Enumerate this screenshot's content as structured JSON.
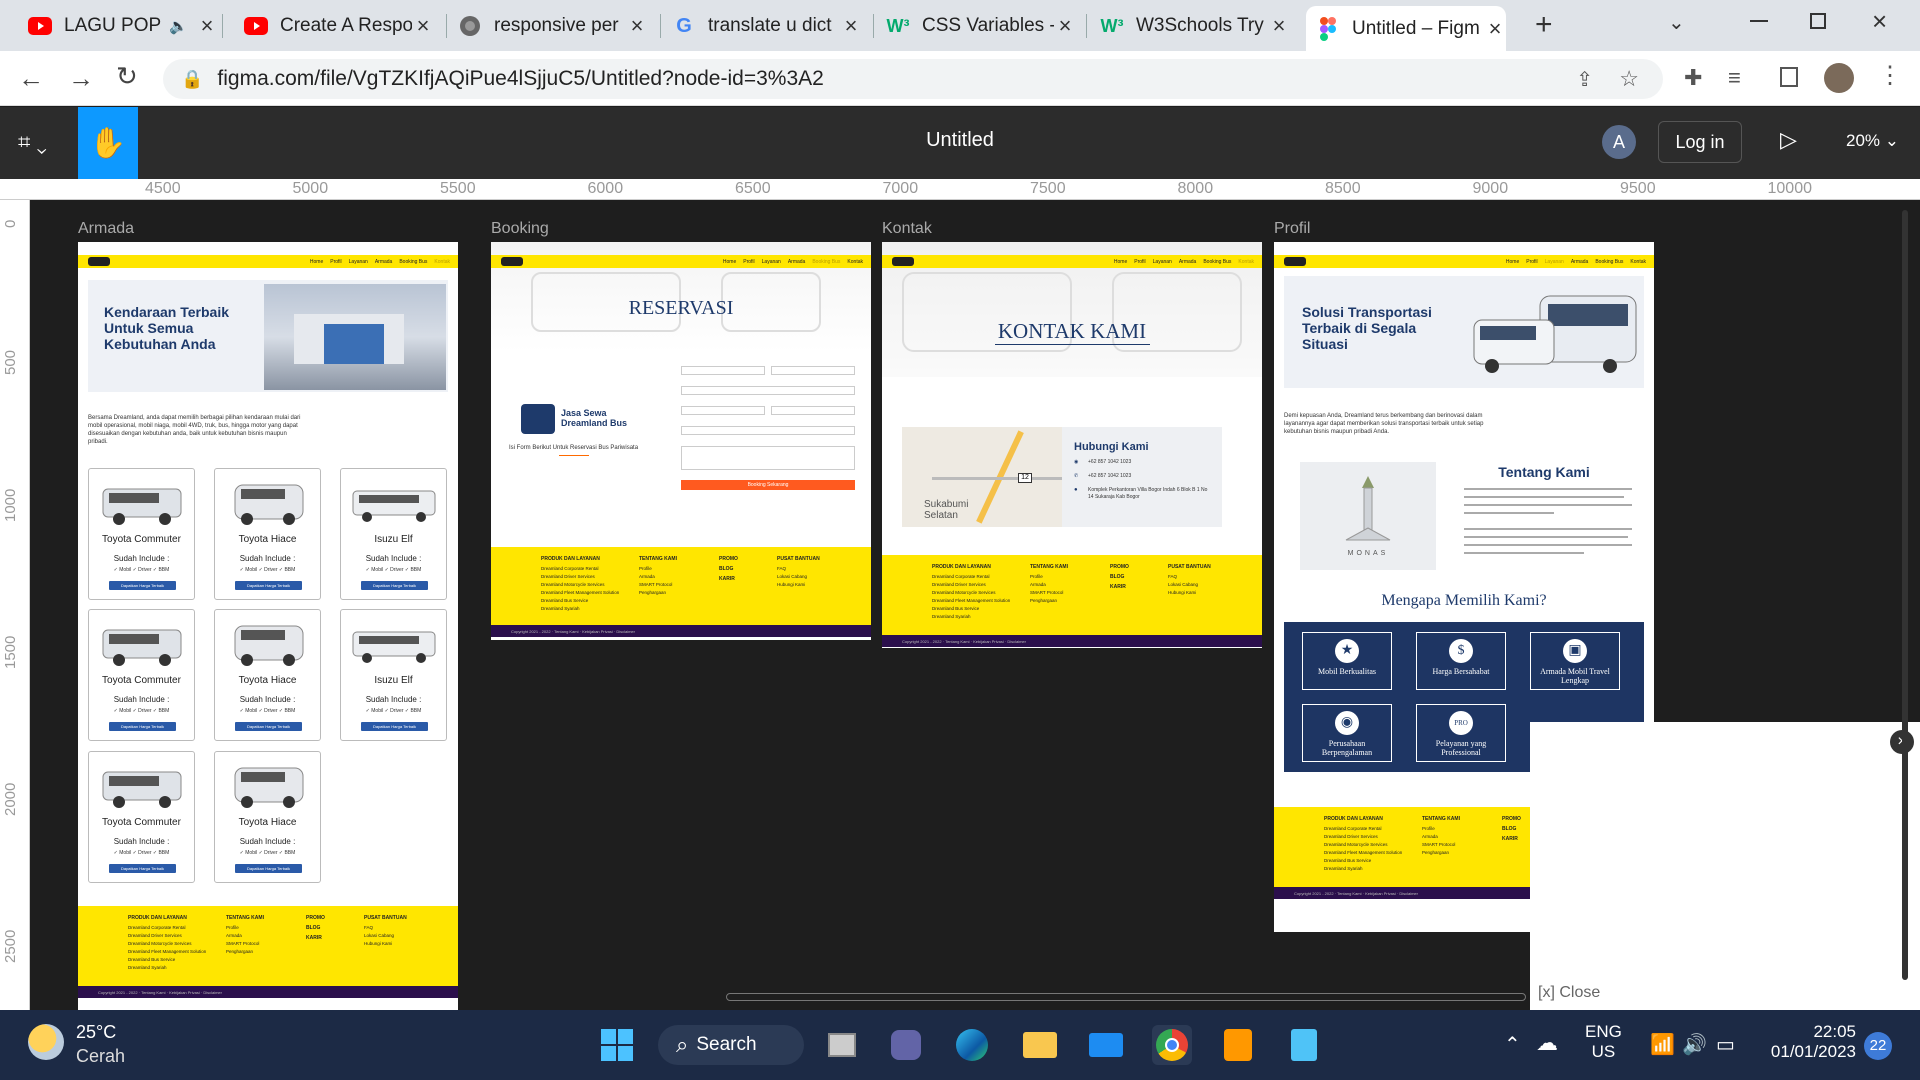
{
  "browser": {
    "tabs": [
      {
        "title": "LAGU POP",
        "icon": "youtube-icon",
        "x": 0
      },
      {
        "title": "Create A Respo",
        "icon": "youtube-icon"
      },
      {
        "title": "responsive per",
        "icon": "globe-icon"
      },
      {
        "title": "translate u dict",
        "icon": "google-icon"
      },
      {
        "title": "CSS Variables -",
        "icon": "w3schools-icon"
      },
      {
        "title": "W3Schools Try",
        "icon": "w3schools-icon"
      },
      {
        "title": "Untitled – Figm",
        "icon": "figma-icon"
      }
    ],
    "url": "figma.com/file/VgTZKIfjAQiPue4lSjjuC5/Untitled?node-id=3%3A2"
  },
  "figma": {
    "title": "Untitled",
    "avatar_letter": "A",
    "login": "Log in",
    "zoom": "20%",
    "ruler_x": [
      "4500",
      "5000",
      "5500",
      "6000",
      "6500",
      "7000",
      "7500",
      "8000",
      "8500",
      "9000",
      "9500",
      "10000"
    ],
    "ruler_y": [
      "0",
      "500",
      "1000",
      "1500",
      "2000",
      "2500"
    ]
  },
  "frames": {
    "armada": {
      "label": "Armada",
      "nav": [
        "Home",
        "Profil",
        "Layanan",
        "Armada",
        "Booking Bus",
        "Kontak"
      ],
      "hero_title": "Kendaraan Terbaik Untuk Semua Kebutuhan Anda",
      "intro": "Bersama Dreamland, anda dapat memilih berbagai pilihan kendaraan mulai dari mobil operasional, mobil niaga, mobil 4WD, truk, bus, hingga motor yang dapat disesuaikan dengan kebutuhan anda, baik untuk kebutuhan bisnis maupun pribadi.",
      "cards": [
        {
          "name": "Toyota Commuter"
        },
        {
          "name": "Toyota Hiace"
        },
        {
          "name": "Isuzu Elf"
        },
        {
          "name": "Toyota Commuter"
        },
        {
          "name": "Toyota Hiace"
        },
        {
          "name": "Isuzu Elf"
        },
        {
          "name": "Toyota Commuter"
        },
        {
          "name": "Toyota Hiace"
        }
      ],
      "include_label": "Sudah Include :",
      "include_items": "✓ Mobil   ✓ Driver   ✓ BBM",
      "cta": "Dapatkan Harga Terbaik"
    },
    "booking": {
      "label": "Booking",
      "nav": [
        "Home",
        "Profil",
        "Layanan",
        "Armada",
        "Booking Bus",
        "Kontak"
      ],
      "hero": "RESERVASI",
      "brand": "Jasa Sewa Dreamland Bus",
      "sub": "Isi Form Berikut Untuk Reservasi Bus Pariwisata",
      "submit": "Booking Sekarang"
    },
    "kontak": {
      "label": "Kontak",
      "nav": [
        "Home",
        "Profil",
        "Layanan",
        "Armada",
        "Booking Bus",
        "Kontak"
      ],
      "hero": "KONTAK KAMI",
      "map_city": "Sukabumi Selatan",
      "heading": "Hubungi Kami",
      "phone1": "+62 857 1042 1023",
      "phone2": "+62 857 1042 1023",
      "address": "Komplek Perkantoran Villa Bogor Indah 6 Blok B 1 No 14 Sukaraja Kab Bogor"
    },
    "profil": {
      "label": "Profil",
      "nav": [
        "Home",
        "Profil",
        "Layanan",
        "Armada",
        "Booking Bus",
        "Kontak"
      ],
      "hero_title": "Solusi Transportasi Terbaik di Segala Situasi",
      "intro": "Demi kepuasan Anda, Dreamland terus berkembang dan berinovasi dalam layanannya agar dapat memberikan solusi transportasi terbaik untuk setiap kebutuhan bisnis maupun pribadi Anda.",
      "about_title": "Tentang Kami",
      "monas": "MONAS",
      "why_title": "Mengapa Memilih Kami?",
      "why": [
        "Mobil Berkualitas",
        "Harga Bersahabat",
        "Armada Mobil Travel Lengkap",
        "Perusahaan Berpengalaman",
        "Pelayanan yang Professional"
      ]
    },
    "footer": {
      "col1_title": "PRODUK DAN LAYANAN",
      "col1": [
        "Dreamland Corporate Rental",
        "Dreamland Driver Services",
        "Dreamland Motorcycle Services",
        "Dreamland Fleet Management Solution",
        "Dreamland Bus Service",
        "Dreamland Syariah"
      ],
      "col2_title": "TENTANG KAMI",
      "col2": [
        "Profile",
        "Armada",
        "SMART Protocol",
        "Penghargaan"
      ],
      "col3_title": "PROMO",
      "col3": [
        "BLOG",
        "KARIR"
      ],
      "col4_title": "PUSAT BANTUAN",
      "col4": [
        "FAQ",
        "Lokasi Cabang",
        "Hubungi Kami"
      ],
      "copyright": "Copyright 2021 - 2022 · Tentang Kami · Kebijakan Privasi · Disclaimer"
    }
  },
  "close_text": "[x] Close",
  "taskbar": {
    "temp": "25°C",
    "weather": "Cerah",
    "search": "Search",
    "lang1": "ENG",
    "lang2": "US",
    "time": "22:05",
    "date": "01/01/2023",
    "notif": "22"
  }
}
